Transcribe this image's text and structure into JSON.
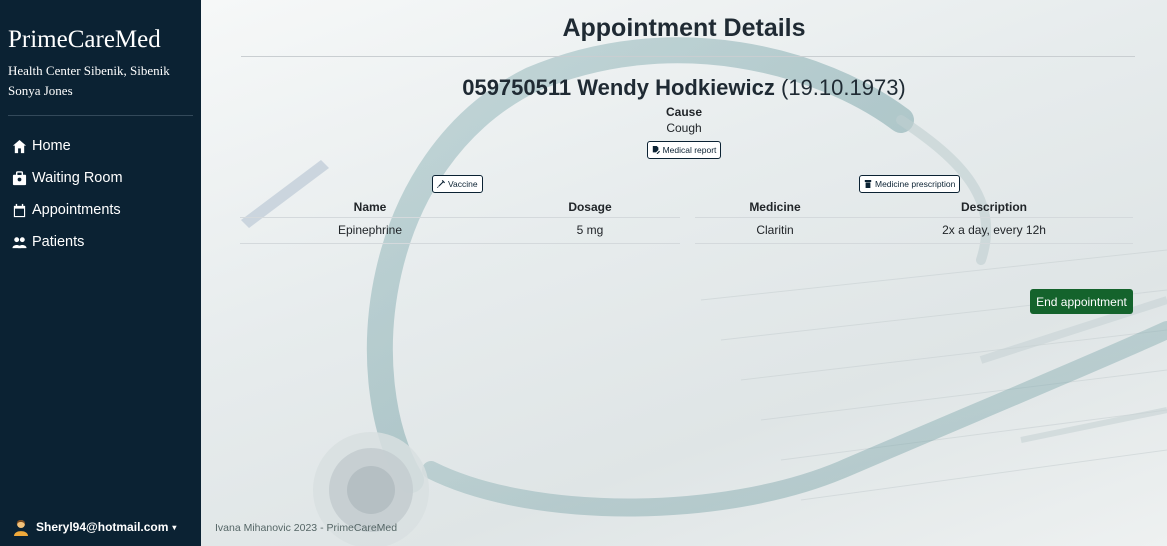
{
  "sidebar": {
    "brand": "PrimeCareMed",
    "center": "Health Center Sibenik, Sibenik",
    "doctor": "Sonya Jones",
    "items": [
      {
        "label": "Home",
        "icon": "home-icon"
      },
      {
        "label": "Waiting Room",
        "icon": "waiting-room-icon"
      },
      {
        "label": "Appointments",
        "icon": "calendar-icon"
      },
      {
        "label": "Patients",
        "icon": "users-icon"
      }
    ],
    "user_email": "Sheryl94@hotmail.com"
  },
  "main": {
    "title": "Appointment Details",
    "patient": {
      "id_name": "059750511 Wendy Hodkiewicz",
      "dob": "(19.10.1973)"
    },
    "cause_label": "Cause",
    "cause_value": "Cough",
    "medical_report_label": "Medical report",
    "vaccine": {
      "button_label": "Vaccine",
      "headers": [
        "Name",
        "Dosage"
      ],
      "rows": [
        [
          "Epinephrine",
          "5 mg"
        ]
      ]
    },
    "prescription": {
      "button_label": "Medicine prescription",
      "headers": [
        "Medicine",
        "Description"
      ],
      "rows": [
        [
          "Claritin",
          "2x a day, every 12h"
        ]
      ]
    },
    "end_button_label": "End appointment",
    "footer": "Ivana Mihanovic 2023 - PrimeCareMed"
  },
  "colors": {
    "sidebar_bg": "#0b2233",
    "end_button_bg": "#14632c"
  }
}
